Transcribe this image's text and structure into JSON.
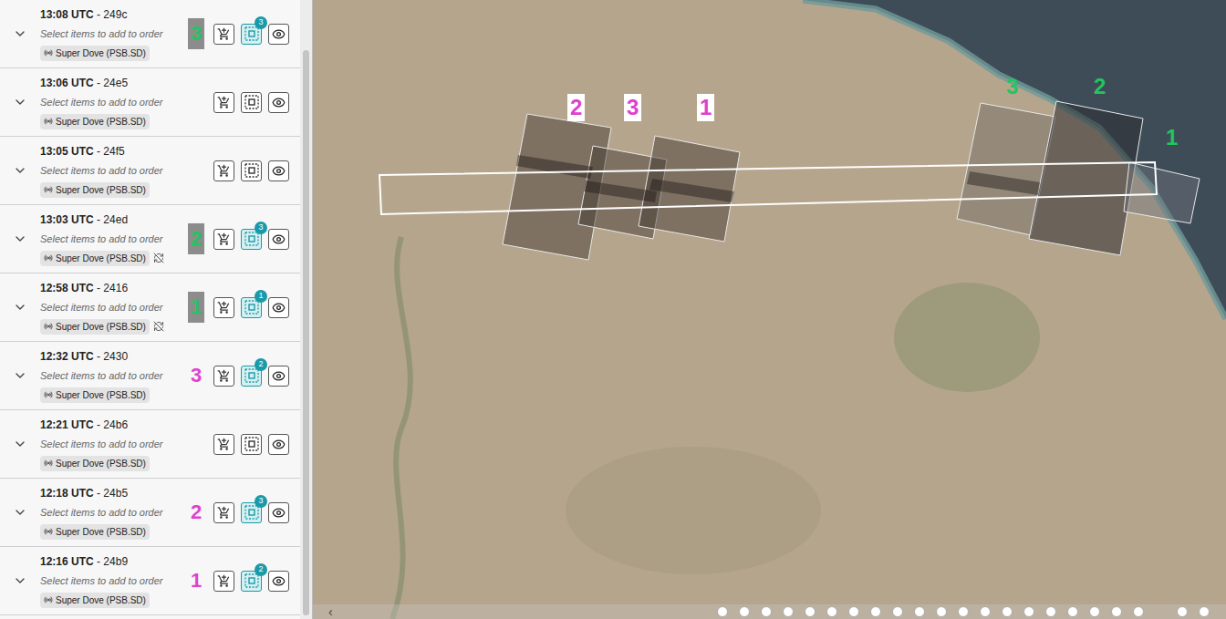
{
  "separator": " - ",
  "scenes": [
    {
      "time": "13:08 UTC",
      "id": "249c",
      "hint": "Select items to add to order",
      "tag": "Super Dove (PSB.SD)",
      "sync_off": false,
      "selected": true,
      "badge": "3",
      "annotation": {
        "label": "3",
        "color": "#22c55e",
        "boxed": true
      }
    },
    {
      "time": "13:06 UTC",
      "id": "24e5",
      "hint": "Select items to add to order",
      "tag": "Super Dove (PSB.SD)",
      "sync_off": false,
      "selected": false,
      "badge": "",
      "annotation": null
    },
    {
      "time": "13:05 UTC",
      "id": "24f5",
      "hint": "Select items to add to order",
      "tag": "Super Dove (PSB.SD)",
      "sync_off": false,
      "selected": false,
      "badge": "",
      "annotation": null
    },
    {
      "time": "13:03 UTC",
      "id": "24ed",
      "hint": "Select items to add to order",
      "tag": "Super Dove (PSB.SD)",
      "sync_off": true,
      "selected": true,
      "badge": "3",
      "annotation": {
        "label": "2",
        "color": "#22c55e",
        "boxed": true
      }
    },
    {
      "time": "12:58 UTC",
      "id": "2416",
      "hint": "Select items to add to order",
      "tag": "Super Dove (PSB.SD)",
      "sync_off": true,
      "selected": true,
      "badge": "1",
      "annotation": {
        "label": "1",
        "color": "#22c55e",
        "boxed": true
      }
    },
    {
      "time": "12:32 UTC",
      "id": "2430",
      "hint": "Select items to add to order",
      "tag": "Super Dove (PSB.SD)",
      "sync_off": false,
      "selected": true,
      "badge": "2",
      "annotation": {
        "label": "3",
        "color": "#e040d0",
        "boxed": false
      }
    },
    {
      "time": "12:21 UTC",
      "id": "24b6",
      "hint": "Select items to add to order",
      "tag": "Super Dove (PSB.SD)",
      "sync_off": false,
      "selected": false,
      "badge": "",
      "annotation": null
    },
    {
      "time": "12:18 UTC",
      "id": "24b5",
      "hint": "Select items to add to order",
      "tag": "Super Dove (PSB.SD)",
      "sync_off": false,
      "selected": true,
      "badge": "3",
      "annotation": {
        "label": "2",
        "color": "#e040d0",
        "boxed": false
      }
    },
    {
      "time": "12:16 UTC",
      "id": "24b9",
      "hint": "Select items to add to order",
      "tag": "Super Dove (PSB.SD)",
      "sync_off": false,
      "selected": true,
      "badge": "2",
      "annotation": {
        "label": "1",
        "color": "#e040d0",
        "boxed": false
      }
    }
  ],
  "map": {
    "labels": [
      {
        "label": "2",
        "color": "#e040d0",
        "boxed": true
      },
      {
        "label": "3",
        "color": "#e040d0",
        "boxed": true
      },
      {
        "label": "1",
        "color": "#e040d0",
        "boxed": true
      },
      {
        "label": "3",
        "color": "#22c55e",
        "boxed": false
      },
      {
        "label": "2",
        "color": "#22c55e",
        "boxed": false
      },
      {
        "label": "1",
        "color": "#22c55e",
        "boxed": false
      }
    ]
  },
  "timeline": {
    "arrow": "‹",
    "dot_count": 22
  }
}
